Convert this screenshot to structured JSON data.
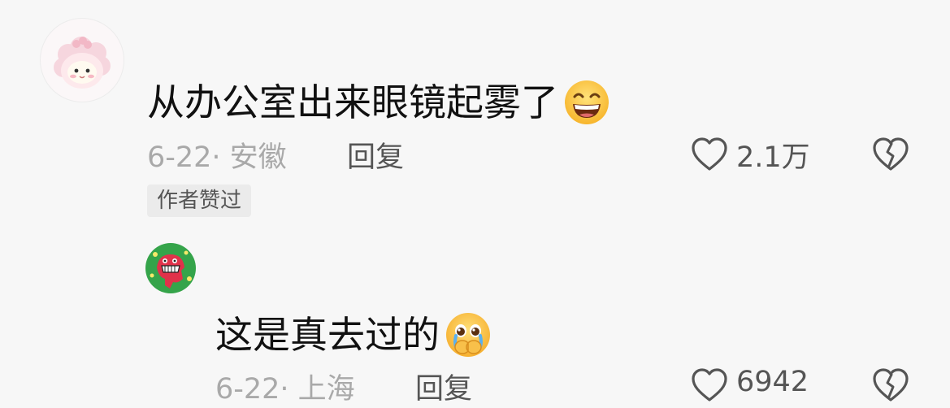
{
  "comments": [
    {
      "username": "",
      "text": "从办公室出来眼镜起雾了",
      "emoji": "grinning-sweat-emoji",
      "meta": "6-22· 安徽",
      "reply_label": "回复",
      "likes": "2.1万",
      "badge": "作者赞过"
    },
    {
      "username": "",
      "text": "这是真去过的",
      "emoji": "teary-pleading-emoji",
      "meta": "6-22· 上海",
      "reply_label": "回复",
      "likes": "6942"
    }
  ],
  "colors": {
    "background": "#f7f7f7",
    "meta_text": "#a9a9a9",
    "badge_bg": "#ebebeb",
    "avatar2_bg": "#35a44a"
  }
}
